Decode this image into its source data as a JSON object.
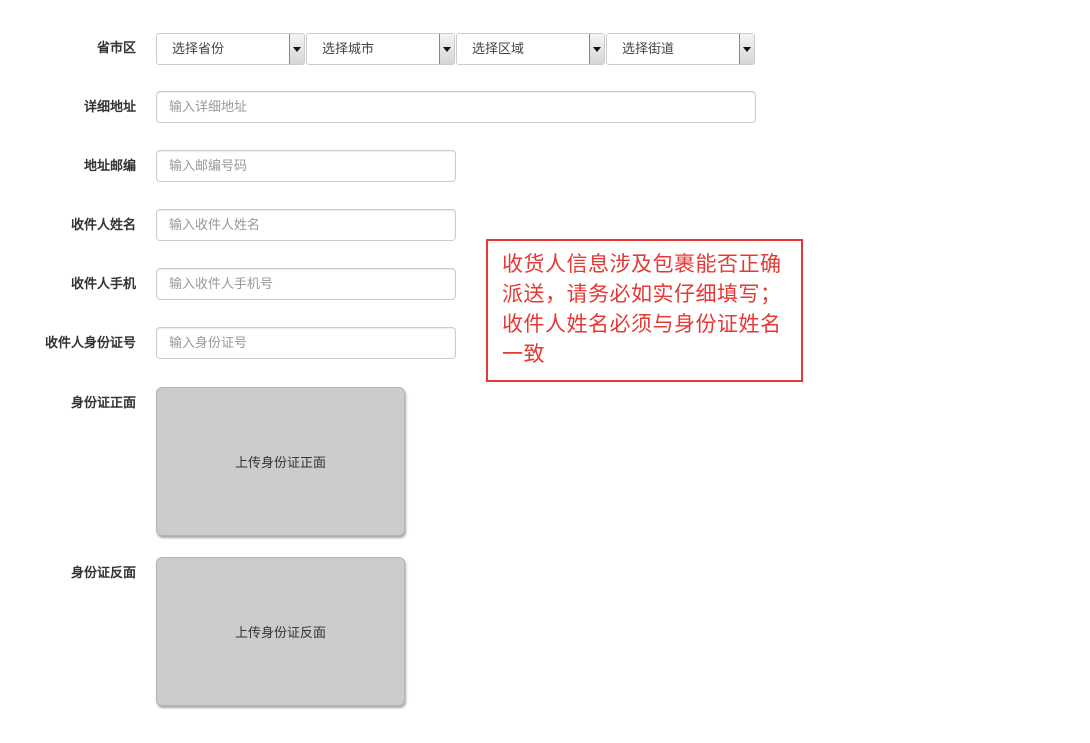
{
  "form": {
    "region": {
      "label": "省市区",
      "province": "选择省份",
      "city": "选择城市",
      "district": "选择区域",
      "street": "选择街道"
    },
    "address": {
      "label": "详细地址",
      "placeholder": "输入详细地址"
    },
    "postcode": {
      "label": "地址邮编",
      "placeholder": "输入邮编号码"
    },
    "recipient_name": {
      "label": "收件人姓名",
      "placeholder": "输入收件人姓名"
    },
    "recipient_phone": {
      "label": "收件人手机",
      "placeholder": "输入收件人手机号"
    },
    "id_number": {
      "label": "收件人身份证号",
      "placeholder": "输入身份证号"
    },
    "id_front": {
      "label": "身份证正面",
      "button": "上传身份证正面"
    },
    "id_back": {
      "label": "身份证反面",
      "button": "上传身份证反面"
    }
  },
  "notice": {
    "text": "收货人信息涉及包裹能否正确派送，请务必如实仔细填写；收件人姓名必须与身份证姓名一致",
    "color": "#e53935"
  },
  "icons": {
    "dropdown": "chevron-down-icon"
  }
}
